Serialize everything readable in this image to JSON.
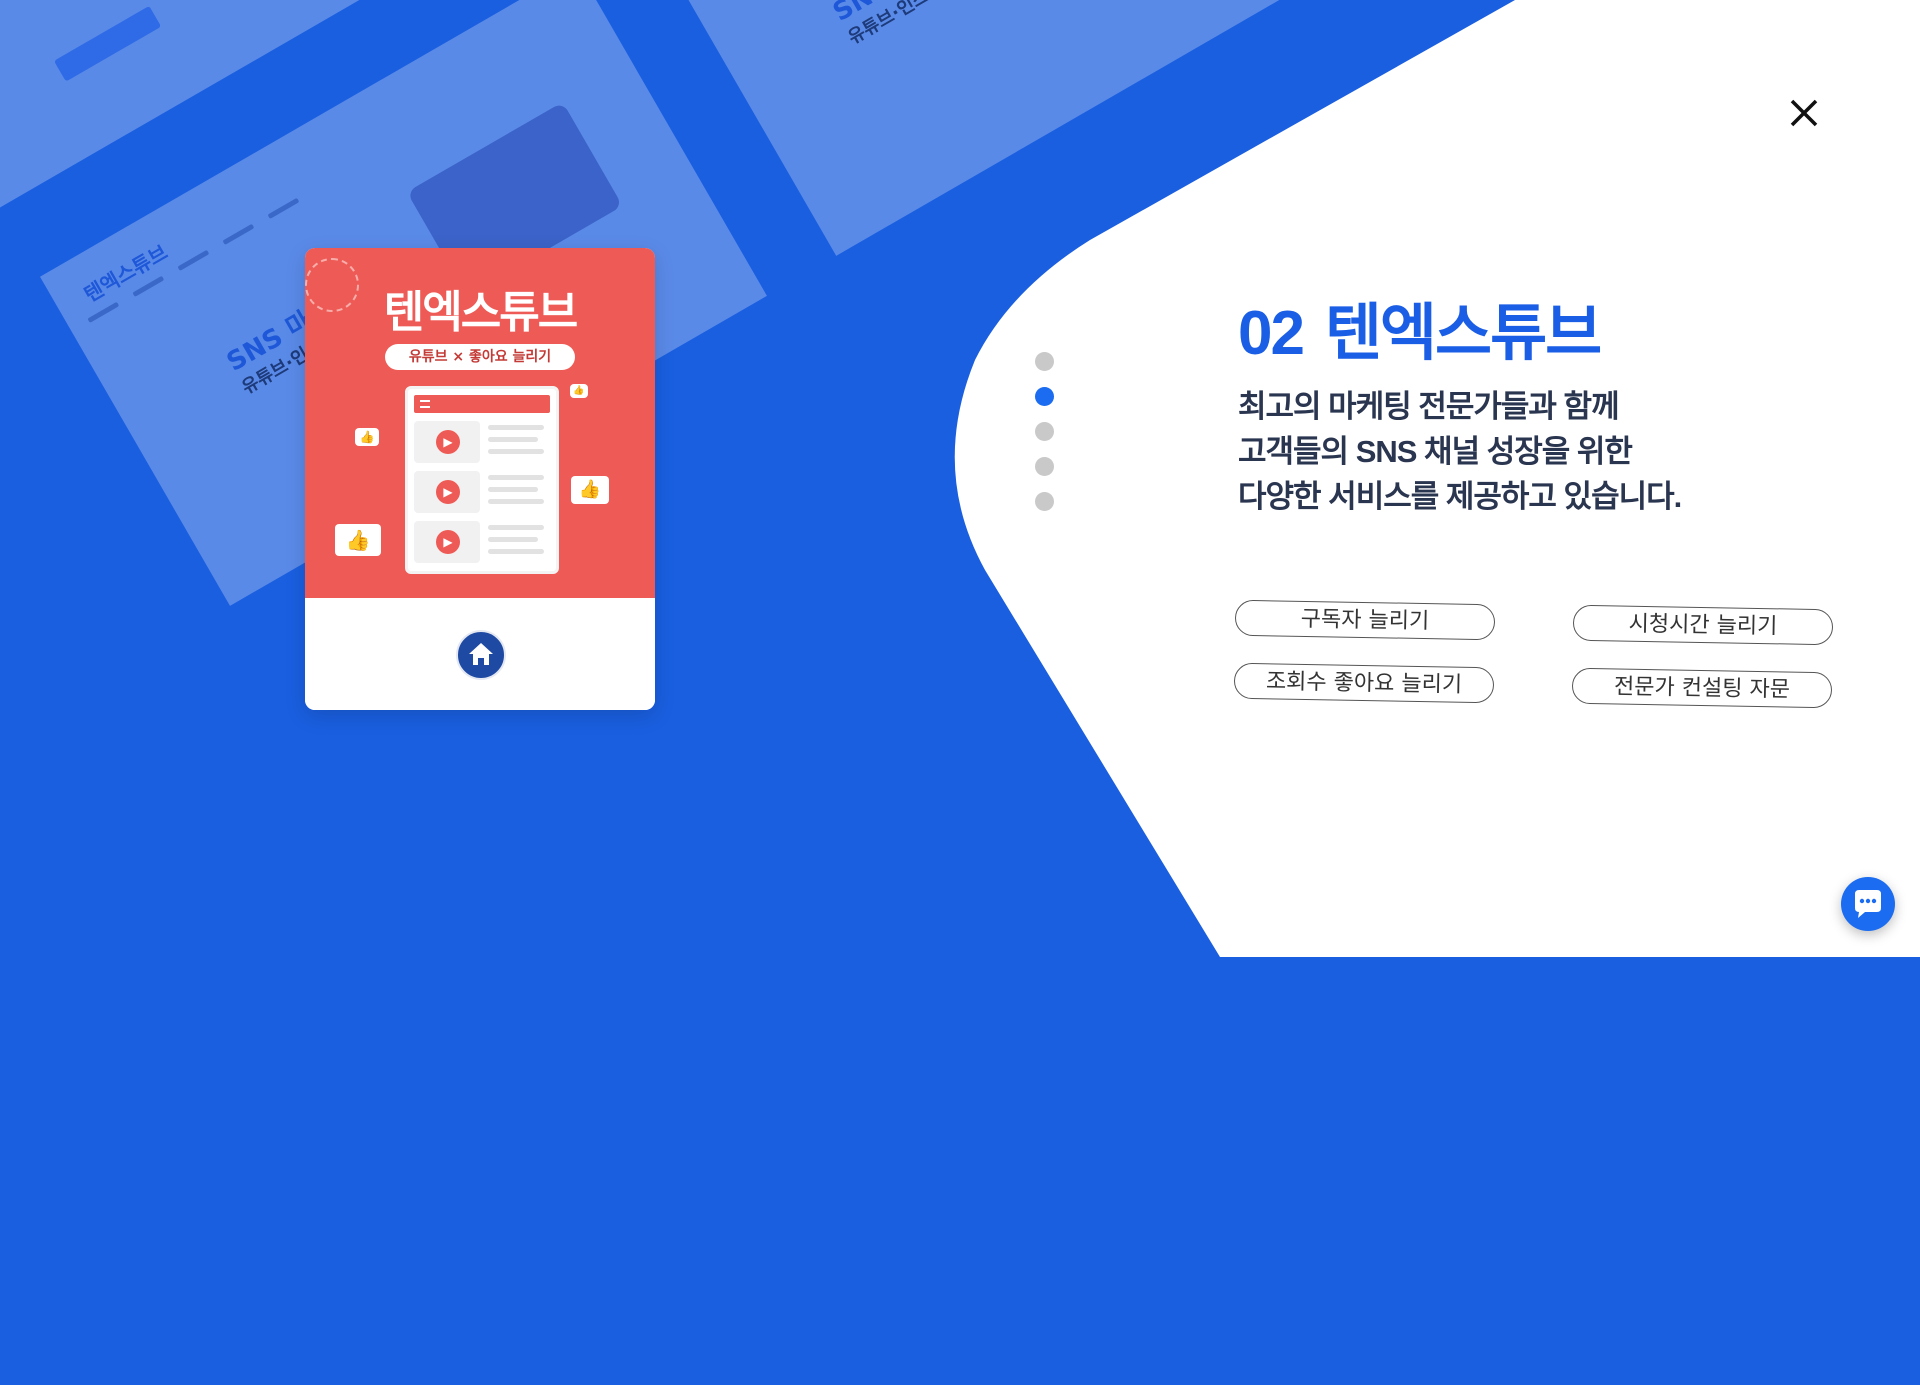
{
  "background": {
    "thumb_title": "SNS 마케팅 전문",
    "thumb_subtitle": "유튜브·인스타·페이스북",
    "thumb_logo": "텐엑스튜브"
  },
  "card": {
    "title": "텐엑스튜브",
    "pill": "유튜브 × 좋아요 늘리기",
    "accent_color": "#ee5a55",
    "home_icon": "home-icon"
  },
  "slider": {
    "total": 5,
    "active_index": 1
  },
  "content": {
    "number": "02",
    "title": "텐엑스튜브",
    "description_lines": [
      "최고의 마케팅 전문가들과 함께",
      "고객들의 SNS 채널 성장을 위한",
      "다양한 서비스를 제공하고 있습니다."
    ],
    "services": [
      "구독자 늘리기",
      "시청시간 늘리기",
      "조회수 좋아요 늘리기",
      "전문가 컨설팅 자문"
    ]
  },
  "colors": {
    "brand_blue": "#1b5ee6",
    "background_blue": "#1a5fe0"
  }
}
